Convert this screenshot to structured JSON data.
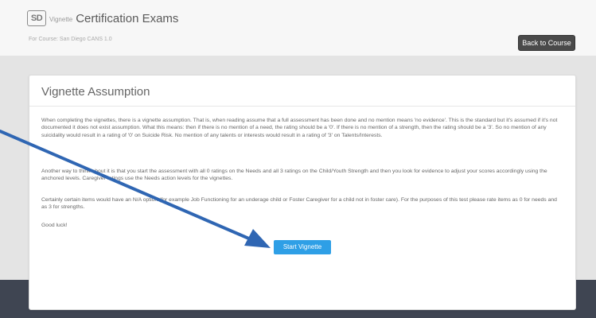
{
  "header": {
    "logo_text": "SD",
    "logo_subtext": "Vignette",
    "title": "Certification Exams",
    "course_name": "For Course: San Diego CANS 1.0",
    "back_button_label": "Back to Course"
  },
  "card": {
    "title": "Vignette Assumption",
    "paragraphs": [
      "When completing the vignettes, there is a vignette assumption. That is, when reading assume that a full assessment has been done and no mention means 'no evidence'. This is the standard but it's assumed if it's not documented it does not exist assumption. What this means: then if there is no mention of a need, the rating should be a '0'. If there is no mention of a strength, then the rating should be a '3'. So no mention of any suicidality would result in a rating of '0' on Suicide Risk. No mention of any talents or interests would result in a rating of '3' on Talents/Interests.",
      "Another way to think about it is that you start the assessment with all 0 ratings on the Needs and all 3 ratings on the Child/Youth Strength and then you look for evidence to adjust your scores accordingly using the anchored levels. Caregiver ratings use the Needs action levels for the vignettes.",
      "Certainly certain items would have an N/A option (for example Job Functioning for an underage child or Foster Caregiver for a child not in foster care). For the purposes of this test please rate items as 0 for needs and as 3 for strengths.",
      "Good luck!"
    ],
    "start_button_label": "Start Vignette"
  },
  "colors": {
    "accent_blue": "#2e9fe6",
    "arrow_blue": "#2f66b3",
    "back_button_bg": "#4a4a4a"
  }
}
